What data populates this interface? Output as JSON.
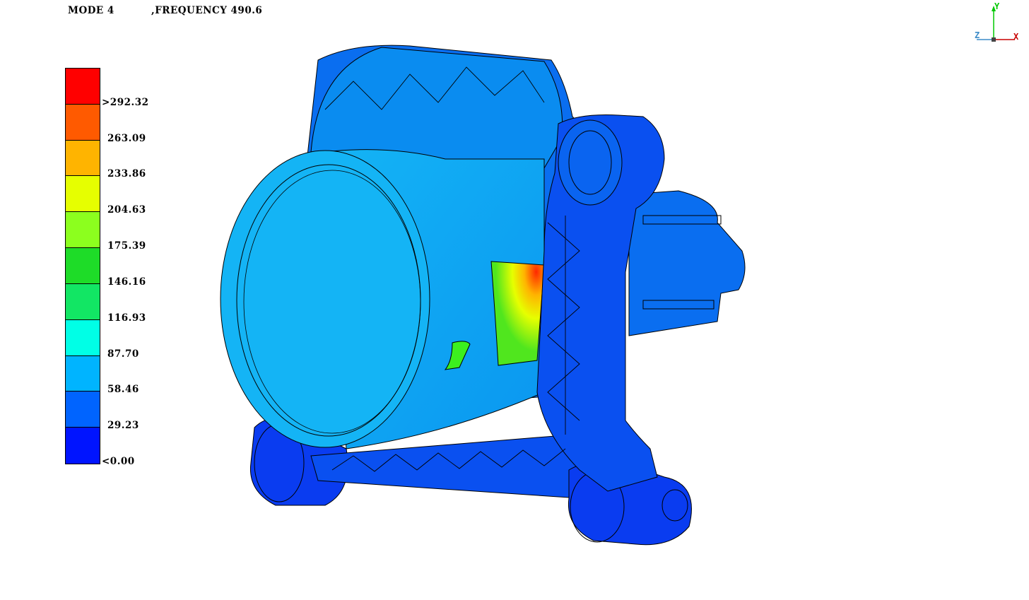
{
  "header": {
    "mode": "MODE 4",
    "frequency": ",FREQUENCY 490.6"
  },
  "legend": {
    "colors": [
      "#ff0000",
      "#ff5a00",
      "#ffb400",
      "#e6ff00",
      "#8cff1e",
      "#1edc28",
      "#12e664",
      "#00ffe6",
      "#00b4ff",
      "#0064ff",
      "#0014ff"
    ],
    "labels": [
      ">292.32",
      "263.09",
      "233.86",
      "204.63",
      "175.39",
      "146.16",
      "116.93",
      "87.70",
      "58.46",
      "29.23",
      "<0.00"
    ]
  },
  "triad": {
    "x_label": "X",
    "y_label": "Y",
    "z_label": "Z"
  },
  "colors": {
    "deep_blue": "#0a3cf0",
    "mid_blue": "#0a6ef0",
    "light_blue": "#0ab4f0",
    "cyan_blue": "#14c8f5"
  }
}
